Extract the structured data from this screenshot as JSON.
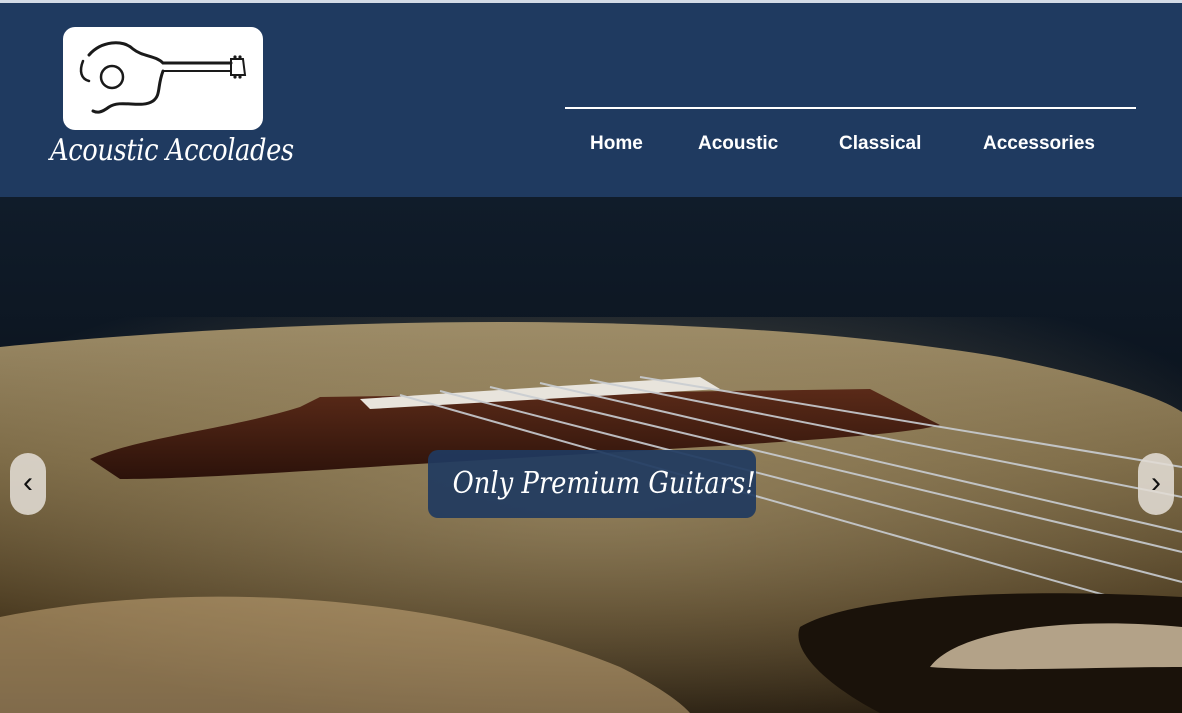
{
  "brand": {
    "name": "Acoustic Accolades",
    "logo_icon": "guitar-outline-icon"
  },
  "nav": {
    "items": [
      "Home",
      "Acoustic",
      "Classical",
      "Accessories"
    ]
  },
  "hero": {
    "caption": "Only Premium Guitars!",
    "prev_icon": "‹",
    "next_icon": "›"
  },
  "colors": {
    "header_bg": "#1f3a60",
    "caption_bg": "#1f3a60",
    "text": "#ffffff"
  }
}
